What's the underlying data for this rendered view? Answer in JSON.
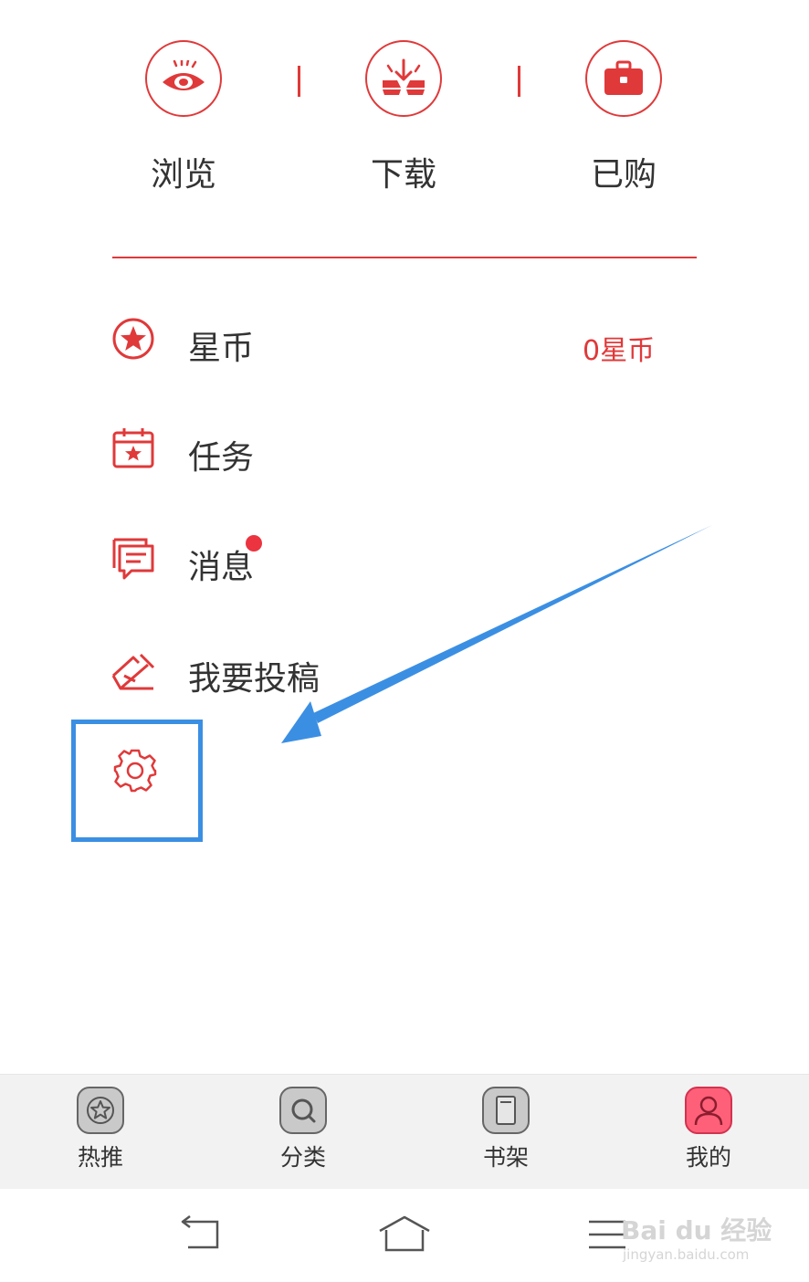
{
  "quick_actions": [
    {
      "label": "浏览",
      "icon": "eye-icon"
    },
    {
      "label": "下载",
      "icon": "download-books-icon"
    },
    {
      "label": "已购",
      "icon": "briefcase-icon"
    }
  ],
  "menu": {
    "stars": {
      "label": "星币",
      "value": "0星币",
      "icon": "star-coin-icon"
    },
    "tasks": {
      "label": "任务",
      "icon": "calendar-star-icon"
    },
    "messages": {
      "label": "消息",
      "icon": "message-icon",
      "has_unread_dot": true
    },
    "submit": {
      "label": "我要投稿",
      "icon": "envelope-pen-icon"
    },
    "settings": {
      "icon": "gear-icon"
    }
  },
  "tabbar": [
    {
      "label": "热推",
      "icon": "star-tab-icon",
      "active": false
    },
    {
      "label": "分类",
      "icon": "search-tab-icon",
      "active": false
    },
    {
      "label": "书架",
      "icon": "book-tab-icon",
      "active": false
    },
    {
      "label": "我的",
      "icon": "user-tab-icon",
      "active": true
    }
  ],
  "system_nav": [
    "back-icon",
    "home-icon",
    "menu-icon"
  ],
  "watermark": {
    "brand": "Bai du 经验",
    "url": "jingyan.baidu.com"
  },
  "colors": {
    "accent": "#e0393a",
    "annotation": "#3b8fe3",
    "active_tab": "#ff6079"
  }
}
